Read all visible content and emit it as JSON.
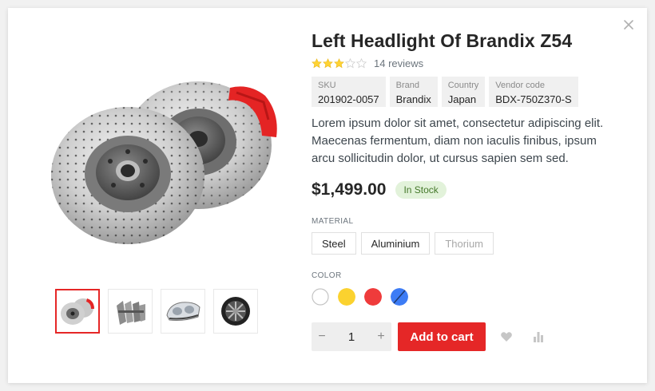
{
  "product": {
    "title": "Left Headlight Of Brandix Z54",
    "rating": 3,
    "rating_max": 5,
    "reviews": "14 reviews",
    "meta": [
      {
        "label": "SKU",
        "value": "201902-0057"
      },
      {
        "label": "Brand",
        "value": "Brandix"
      },
      {
        "label": "Country",
        "value": "Japan"
      },
      {
        "label": "Vendor code",
        "value": "BDX-750Z370-S"
      }
    ],
    "description": "Lorem ipsum dolor sit amet, consectetur adipiscing elit. Maecenas fermentum, diam non iaculis finibus, ipsum arcu sollicitudin dolor, ut cursus sapien sem sed.",
    "price": "$1,499.00",
    "stock": "In Stock"
  },
  "options": {
    "material_label": "MATERIAL",
    "materials": [
      {
        "label": "Steel",
        "available": true
      },
      {
        "label": "Aluminium",
        "available": true
      },
      {
        "label": "Thorium",
        "available": false
      }
    ],
    "color_label": "COLOR",
    "colors": [
      {
        "name": "white",
        "hex": "#ffffff",
        "available": true
      },
      {
        "name": "yellow",
        "hex": "#fbd22f",
        "available": true
      },
      {
        "name": "red",
        "hex": "#ef3b3b",
        "available": true
      },
      {
        "name": "blue",
        "hex": "#3d7cf5",
        "available": false
      }
    ]
  },
  "cart": {
    "quantity": "1",
    "minus": "−",
    "plus": "+",
    "add_label": "Add to cart"
  },
  "gallery": {
    "thumbnails": [
      "brake-disc-icon",
      "brake-pads-icon",
      "headlight-icon",
      "wheel-rim-icon"
    ],
    "active_index": 0
  },
  "colors": {
    "accent": "#e52727",
    "star": "#ffd333",
    "stock_bg": "#e2f2da",
    "stock_text": "#44782a"
  },
  "icons": {
    "close": "close-icon",
    "wishlist": "heart-icon",
    "compare": "compare-icon"
  }
}
